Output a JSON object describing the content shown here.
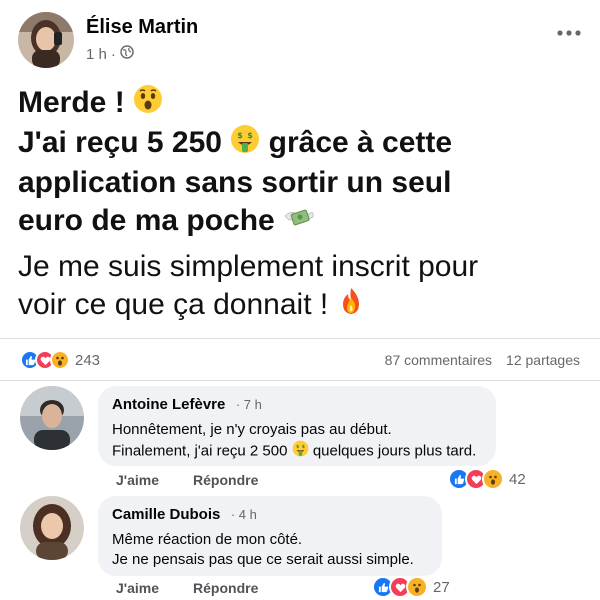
{
  "post": {
    "author": "Élise Martin",
    "time": "1 h",
    "separator": "·",
    "title_line1": "Merde !",
    "title_line2_prefix": "J'ai reçu 5 250",
    "title_line2_suffix": "grâce à cette",
    "title_line3": "application sans sortir un seul",
    "title_line4": "euro de ma poche",
    "para_line1": "Je me suis simplement inscrit pour",
    "para_line2": "voir ce que ça donnait !"
  },
  "stats": {
    "reactions_count": "243",
    "comments": "87 commentaires",
    "shares": "12 partages"
  },
  "comments": [
    {
      "author": "Antoine Lefèvre",
      "time": "7 h",
      "line1": "Honnêtement, je n'y croyais pas au début.",
      "line2_prefix": "Finalement, j'ai reçu 2 500",
      "line2_suffix": "quelques jours plus tard.",
      "like_label": "J'aime",
      "reply_label": "Répondre",
      "reactions_count": "42"
    },
    {
      "author": "Camille Dubois",
      "time": "4 h",
      "line1": "Même réaction de mon côté.",
      "line2": "Je ne pensais pas que ce serait aussi simple.",
      "like_label": "J'aime",
      "reply_label": "Répondre",
      "reactions_count": "27"
    }
  ],
  "colors": {
    "like_blue": "#1877f2",
    "love_red": "#f33e58",
    "wow_yellow": "#f7b125",
    "muted_text": "#65676b",
    "bubble_bg": "#f0f2f5"
  },
  "icons": [
    "more-dots-icon",
    "globe-icon",
    "surprised-emoji-icon",
    "money-mouth-emoji-icon",
    "flying-money-emoji-icon",
    "fire-emoji-icon",
    "like-reaction-icon",
    "love-reaction-icon",
    "wow-reaction-icon"
  ]
}
